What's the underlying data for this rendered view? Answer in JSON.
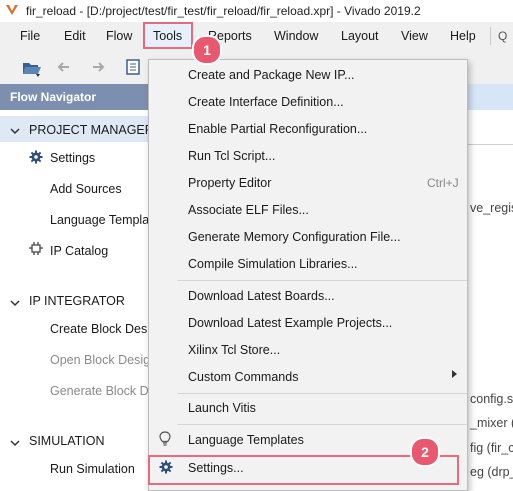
{
  "window": {
    "title": "fir_reload - [D:/project/test/fir_test/fir_reload/fir_reload.xpr] - Vivado 2019.2"
  },
  "menubar": {
    "items": [
      {
        "label": "File"
      },
      {
        "label": "Edit"
      },
      {
        "label": "Flow"
      },
      {
        "label": "Tools"
      },
      {
        "label": "Reports"
      },
      {
        "label": "Window"
      },
      {
        "label": "Layout"
      },
      {
        "label": "View"
      },
      {
        "label": "Help"
      }
    ],
    "search_placeholder": "Q"
  },
  "flow_navigator": {
    "title": "Flow Navigator",
    "sections": [
      {
        "label": "PROJECT MANAGER",
        "items": [
          "Settings",
          "Add Sources",
          "Language Templa",
          "IP Catalog"
        ]
      },
      {
        "label": "IP INTEGRATOR",
        "items": [
          "Create Block Desi",
          "Open Block Desig",
          "Generate Block D"
        ]
      },
      {
        "label": "SIMULATION",
        "items": [
          "Run Simulation"
        ]
      }
    ]
  },
  "background": {
    "right_fragments": [
      "ve_regis",
      "config.sv",
      "_mixer (c",
      "fig (fir_c",
      "eg (drp_"
    ]
  },
  "tools_menu": {
    "items": [
      {
        "label": "Create and Package New IP..."
      },
      {
        "label": "Create Interface Definition..."
      },
      {
        "label": "Enable Partial Reconfiguration..."
      },
      {
        "label": "Run Tcl Script..."
      },
      {
        "label": "Property Editor",
        "shortcut": "Ctrl+J"
      },
      {
        "label": "Associate ELF Files..."
      },
      {
        "label": "Generate Memory Configuration File..."
      },
      {
        "label": "Compile Simulation Libraries..."
      },
      {
        "label": "Download Latest Boards..."
      },
      {
        "label": "Download Latest Example Projects..."
      },
      {
        "label": "Xilinx Tcl Store..."
      },
      {
        "label": "Custom Commands"
      },
      {
        "label": "Launch Vitis"
      },
      {
        "label": "Language Templates"
      },
      {
        "label": "Settings..."
      }
    ]
  },
  "annotations": {
    "step1": "1",
    "step2": "2",
    "highlight_color": "#e86a7e"
  }
}
